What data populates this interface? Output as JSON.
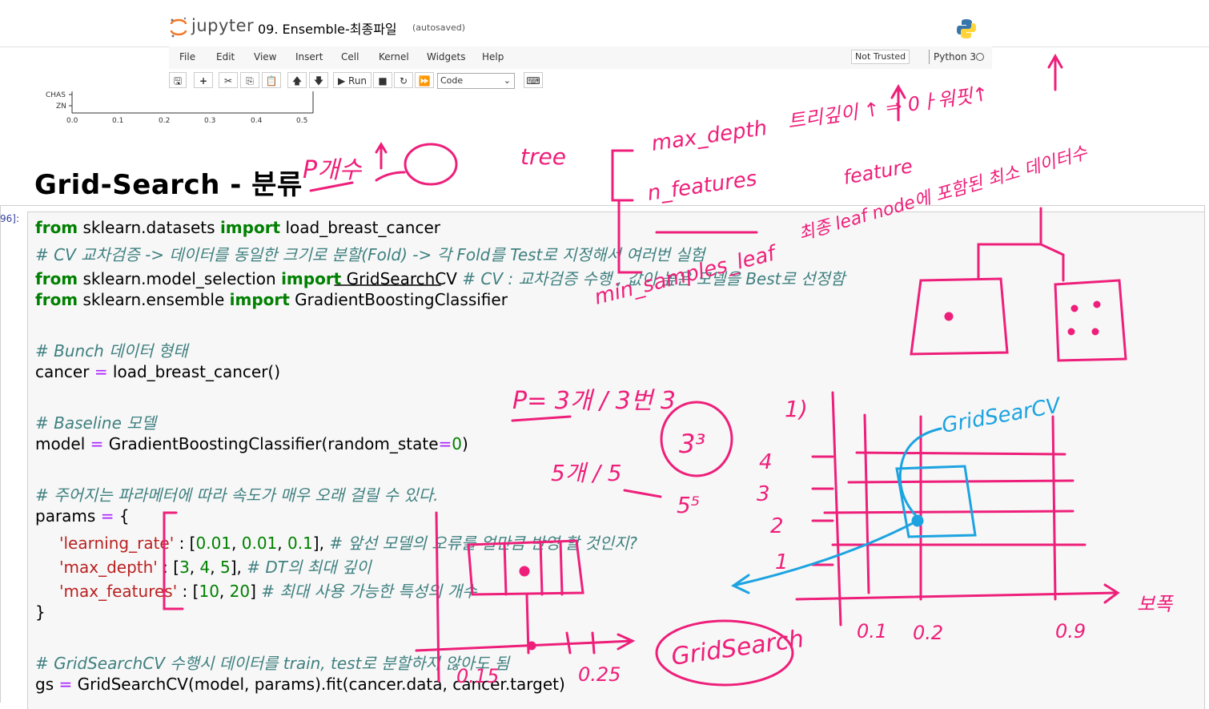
{
  "header": {
    "logo_text": "jupyter",
    "notebook_name": "09. Ensemble-최종파일",
    "autosave": "(autosaved)"
  },
  "menu": [
    "File",
    "Edit",
    "View",
    "Insert",
    "Cell",
    "Kernel",
    "Widgets",
    "Help"
  ],
  "trust": "Not Trusted",
  "kernel": "Python 3",
  "toolbar": {
    "run_label": "Run",
    "cell_type": "Code"
  },
  "plot": {
    "y_labels": [
      "CHAS",
      "ZN"
    ],
    "x_ticks": [
      "0.0",
      "0.1",
      "0.2",
      "0.3",
      "0.4",
      "0.5"
    ]
  },
  "heading": "Grid-Search - 분류",
  "cell_prompt": "96]:",
  "code": {
    "l1_kw1": "from",
    "l1_mod": " sklearn.datasets ",
    "l1_kw2": "import",
    "l1_name": " load_breast_cancer",
    "l2": "# CV 교차검증 -> 데이터를 동일한 크기로 분할(Fold) -> 각 Fold를 Test로 지정해서 여러번 실험",
    "l3_kw1": "from",
    "l3_mod": " sklearn.model_selection ",
    "l3_kw2": "import",
    "l3_name": " GridSearchCV",
    "l3_cm": " # CV : 교차검증 수행 , 값이 높은 모델을 Best로 선정함",
    "l4_kw1": "from",
    "l4_mod": " sklearn.ensemble ",
    "l4_kw2": "import",
    "l4_name": " GradientBoostingClassifier",
    "l6": "# Bunch 데이터 형태",
    "l7_a": "cancer ",
    "l7_op": "=",
    "l7_b": " load_breast_cancer()",
    "l9": "# Baseline 모델",
    "l10_a": "model ",
    "l10_op": "=",
    "l10_b": " GradientBoostingClassifier(random_state",
    "l10_op2": "=",
    "l10_num": "0",
    "l10_c": ")",
    "l12": "# 주어지는 파라메터에 따라 속도가 매우 오래 걸릴 수 있다.",
    "l13_a": "params ",
    "l13_op": "=",
    "l13_b": " {",
    "l14_st": "'learning_rate'",
    "l14_a": " : [",
    "l14_n1": "0.01",
    "l14_b": ", ",
    "l14_n2": "0.01",
    "l14_c": ", ",
    "l14_n3": "0.1",
    "l14_d": "], ",
    "l14_cm": "# 앞선 모델의 오류를 얼만큼 반영 할 것인지?",
    "l15_st": "'max_depth'",
    "l15_a": " : [",
    "l15_n1": "3",
    "l15_b": ", ",
    "l15_n2": "4",
    "l15_c": ", ",
    "l15_n3": "5",
    "l15_d": "], ",
    "l15_cm": "# DT의 최대 깊이",
    "l16_st": "'max_features'",
    "l16_a": " : [",
    "l16_n1": "10",
    "l16_b": ", ",
    "l16_n2": "20",
    "l16_c": "] ",
    "l16_cm": "# 최대 사용 가능한 특성의 개수",
    "l17": "}",
    "l19": "# GridSearchCV 수행시 데이터를 train, test로 분할하지 않아도 됨",
    "l20_a": "gs ",
    "l20_op": "=",
    "l20_b": " GridSearchCV(model, params).fit(cancer.data, cancer.target)"
  },
  "annotations": {
    "p_count": "P개수",
    "tree": "tree",
    "max_depth": "max_depth",
    "max_depth_note": "트리깊이 ↑ ⇒ 0ㅏ워핏↑",
    "n_features": "n_features",
    "n_features_note": "feature",
    "min_samples_leaf": "min_samples_leaf",
    "leaf_note": "최종 leaf node에 포함된 최소 데이터수",
    "p_eq": "P= 3개 / 3번 3",
    "cube": "3³",
    "five": "5개 / 5",
    "five_pow": "5⁵",
    "grid_cv": "GridSearCV",
    "gridsearch": "GridSearch",
    "axis_y": [
      "1)",
      "4",
      "3",
      "2",
      "1"
    ],
    "axis_x": [
      "0.1",
      "0.2",
      "0.9"
    ],
    "lr_axis": [
      "0.15",
      "0.25"
    ],
    "lr_word": "보폭"
  }
}
